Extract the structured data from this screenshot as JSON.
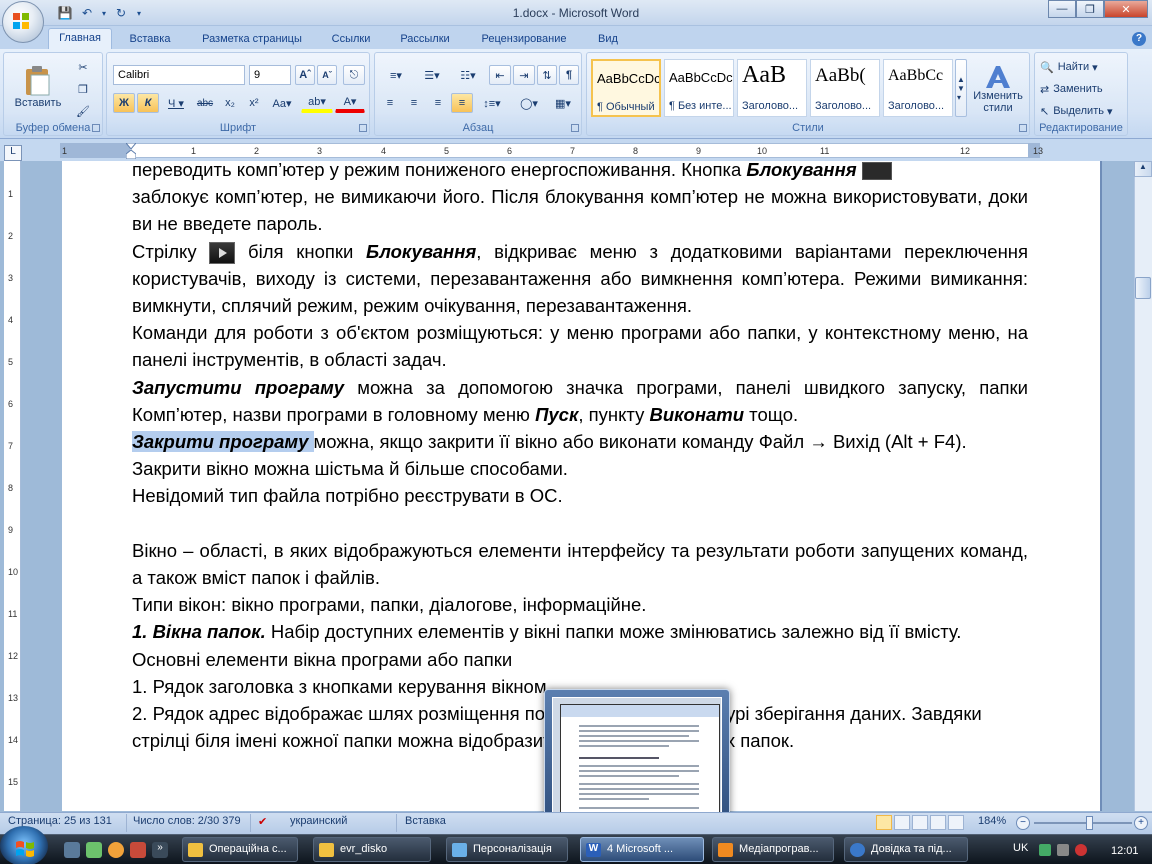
{
  "window": {
    "title": "1.docx - Microsoft Word"
  },
  "tabs": [
    "Главная",
    "Вставка",
    "Разметка страницы",
    "Ссылки",
    "Рассылки",
    "Рецензирование",
    "Вид"
  ],
  "ribbon": {
    "clipboard": {
      "label": "Буфер обмена",
      "paste": "Вставить"
    },
    "font": {
      "label": "Шрифт",
      "font_name": "Calibri",
      "font_size": "9"
    },
    "paragraph": {
      "label": "Абзац"
    },
    "styles": {
      "label": "Стили",
      "items": [
        {
          "sample": "AaBbCcDc",
          "name": "¶ Обычный",
          "selected": true
        },
        {
          "sample": "AaBbCcDc",
          "name": "¶ Без инте..."
        },
        {
          "sample": "AaB",
          "name": "Заголово..."
        },
        {
          "sample": "AaBb(",
          "name": "Заголово..."
        },
        {
          "sample": "AaBbCc",
          "name": "Заголово..."
        }
      ],
      "change_styles": "Изменить стили"
    },
    "editing": {
      "label": "Редактирование",
      "find": "Найти",
      "replace": "Заменить",
      "select": "Выделить"
    }
  },
  "ruler": {
    "numbers": [
      "1",
      "1",
      "2",
      "3",
      "4",
      "5",
      "6",
      "7",
      "8",
      "9",
      "10",
      "11",
      "12",
      "13"
    ]
  },
  "vruler": {
    "numbers": [
      "1",
      "2",
      "3",
      "4",
      "5",
      "6",
      "7",
      "8",
      "9",
      "10",
      "11",
      "12",
      "13",
      "14",
      "15"
    ]
  },
  "document": {
    "line0": "переводить комп’ютер у режим пониженого енергоспоживання. Кнопка ",
    "line0_bi": "Блокування",
    "p1": "заблокує комп’ютер, не вимикаючи його. Після блокування комп’ютер не можна використовувати, доки ви не введете пароль.",
    "p2_a": "Стрілку ",
    "p2_b": " біля кнопки ",
    "p2_bi": "Блокування",
    "p2_c": ", відкриває меню з додатковими варіантами переключення користувачів, виходу із системи, перезавантаження або вимкнення комп’ютера. Режими вимикання: вимкнути, сплячий режим, режим очікування, перезавантаження.",
    "p3": "Команди для роботи з об'єктом розміщуються: у меню програми або папки, у контекстному меню, на панелі інструментів, в області задач.",
    "p4_bi": "Запустити програму",
    "p4_a": " можна за допомогою значка програми, панелі швидкого запуску, папки Комп’ютер, назви програми в головному меню ",
    "p4_bi2": "Пуск",
    "p4_b": ", пункту ",
    "p4_bi3": "Виконати",
    "p4_c": " тощо.",
    "p5_bi": "Закрити програму ",
    "p5_a": "можна, якщо закрити її вікно або виконати команду Файл → Вихід (Alt + F4).",
    "p6": "Закрити вікно можна шістьма й більше способами.",
    "p7": "Невідомий тип файла потрібно реєструвати в ОС.",
    "p8": "Вікно – області, в яких відображуються елементи інтерфейсу та результати роботи запущених команд, а також вміст папок і файлів.",
    "p9": "Типи вікон: вікно програми, папки, діалогове, інформаційне.",
    "p10_bi": "1. Вікна папок.",
    "p10_a": " Набір доступних елементів у вікні папки може змінюватись залежно від її вмісту.",
    "p11": "Основні елементи вікна програми або папки",
    "p12": "1. Рядок заголовка з кнопками керування вікном.",
    "p13": "2. Рядок адрес відображає шлях розміщення поточної папки в структурі зберігання даних. Завдяки",
    "p14": "стрілці біля імені кожної папки можна відобразити список її вкладених папок."
  },
  "statusbar": {
    "page": "Страница: 25 из 131",
    "words": "Число слов: 2/30 379",
    "language": "украинский",
    "mode": "Вставка",
    "zoom": "184%"
  },
  "taskbar": {
    "items": [
      {
        "label": "Операційна с...",
        "color": "#f0c040"
      },
      {
        "label": "evr_disko",
        "color": "#f0c040"
      },
      {
        "label": "Персоналізація",
        "color": "#6ab0e8"
      },
      {
        "label": "4 Microsoft ...",
        "color": "#2b5fb8",
        "active": true
      },
      {
        "label": "Медіапрограв...",
        "color": "#f08a20"
      },
      {
        "label": "Довідка та під...",
        "color": "#3a78c9"
      }
    ],
    "tray": {
      "lang": "UK",
      "time": "12:01"
    }
  },
  "colors": {
    "highlight": "#b4cdee",
    "ribbon": "#d5e3f5",
    "taskbar": "#1d2836"
  }
}
